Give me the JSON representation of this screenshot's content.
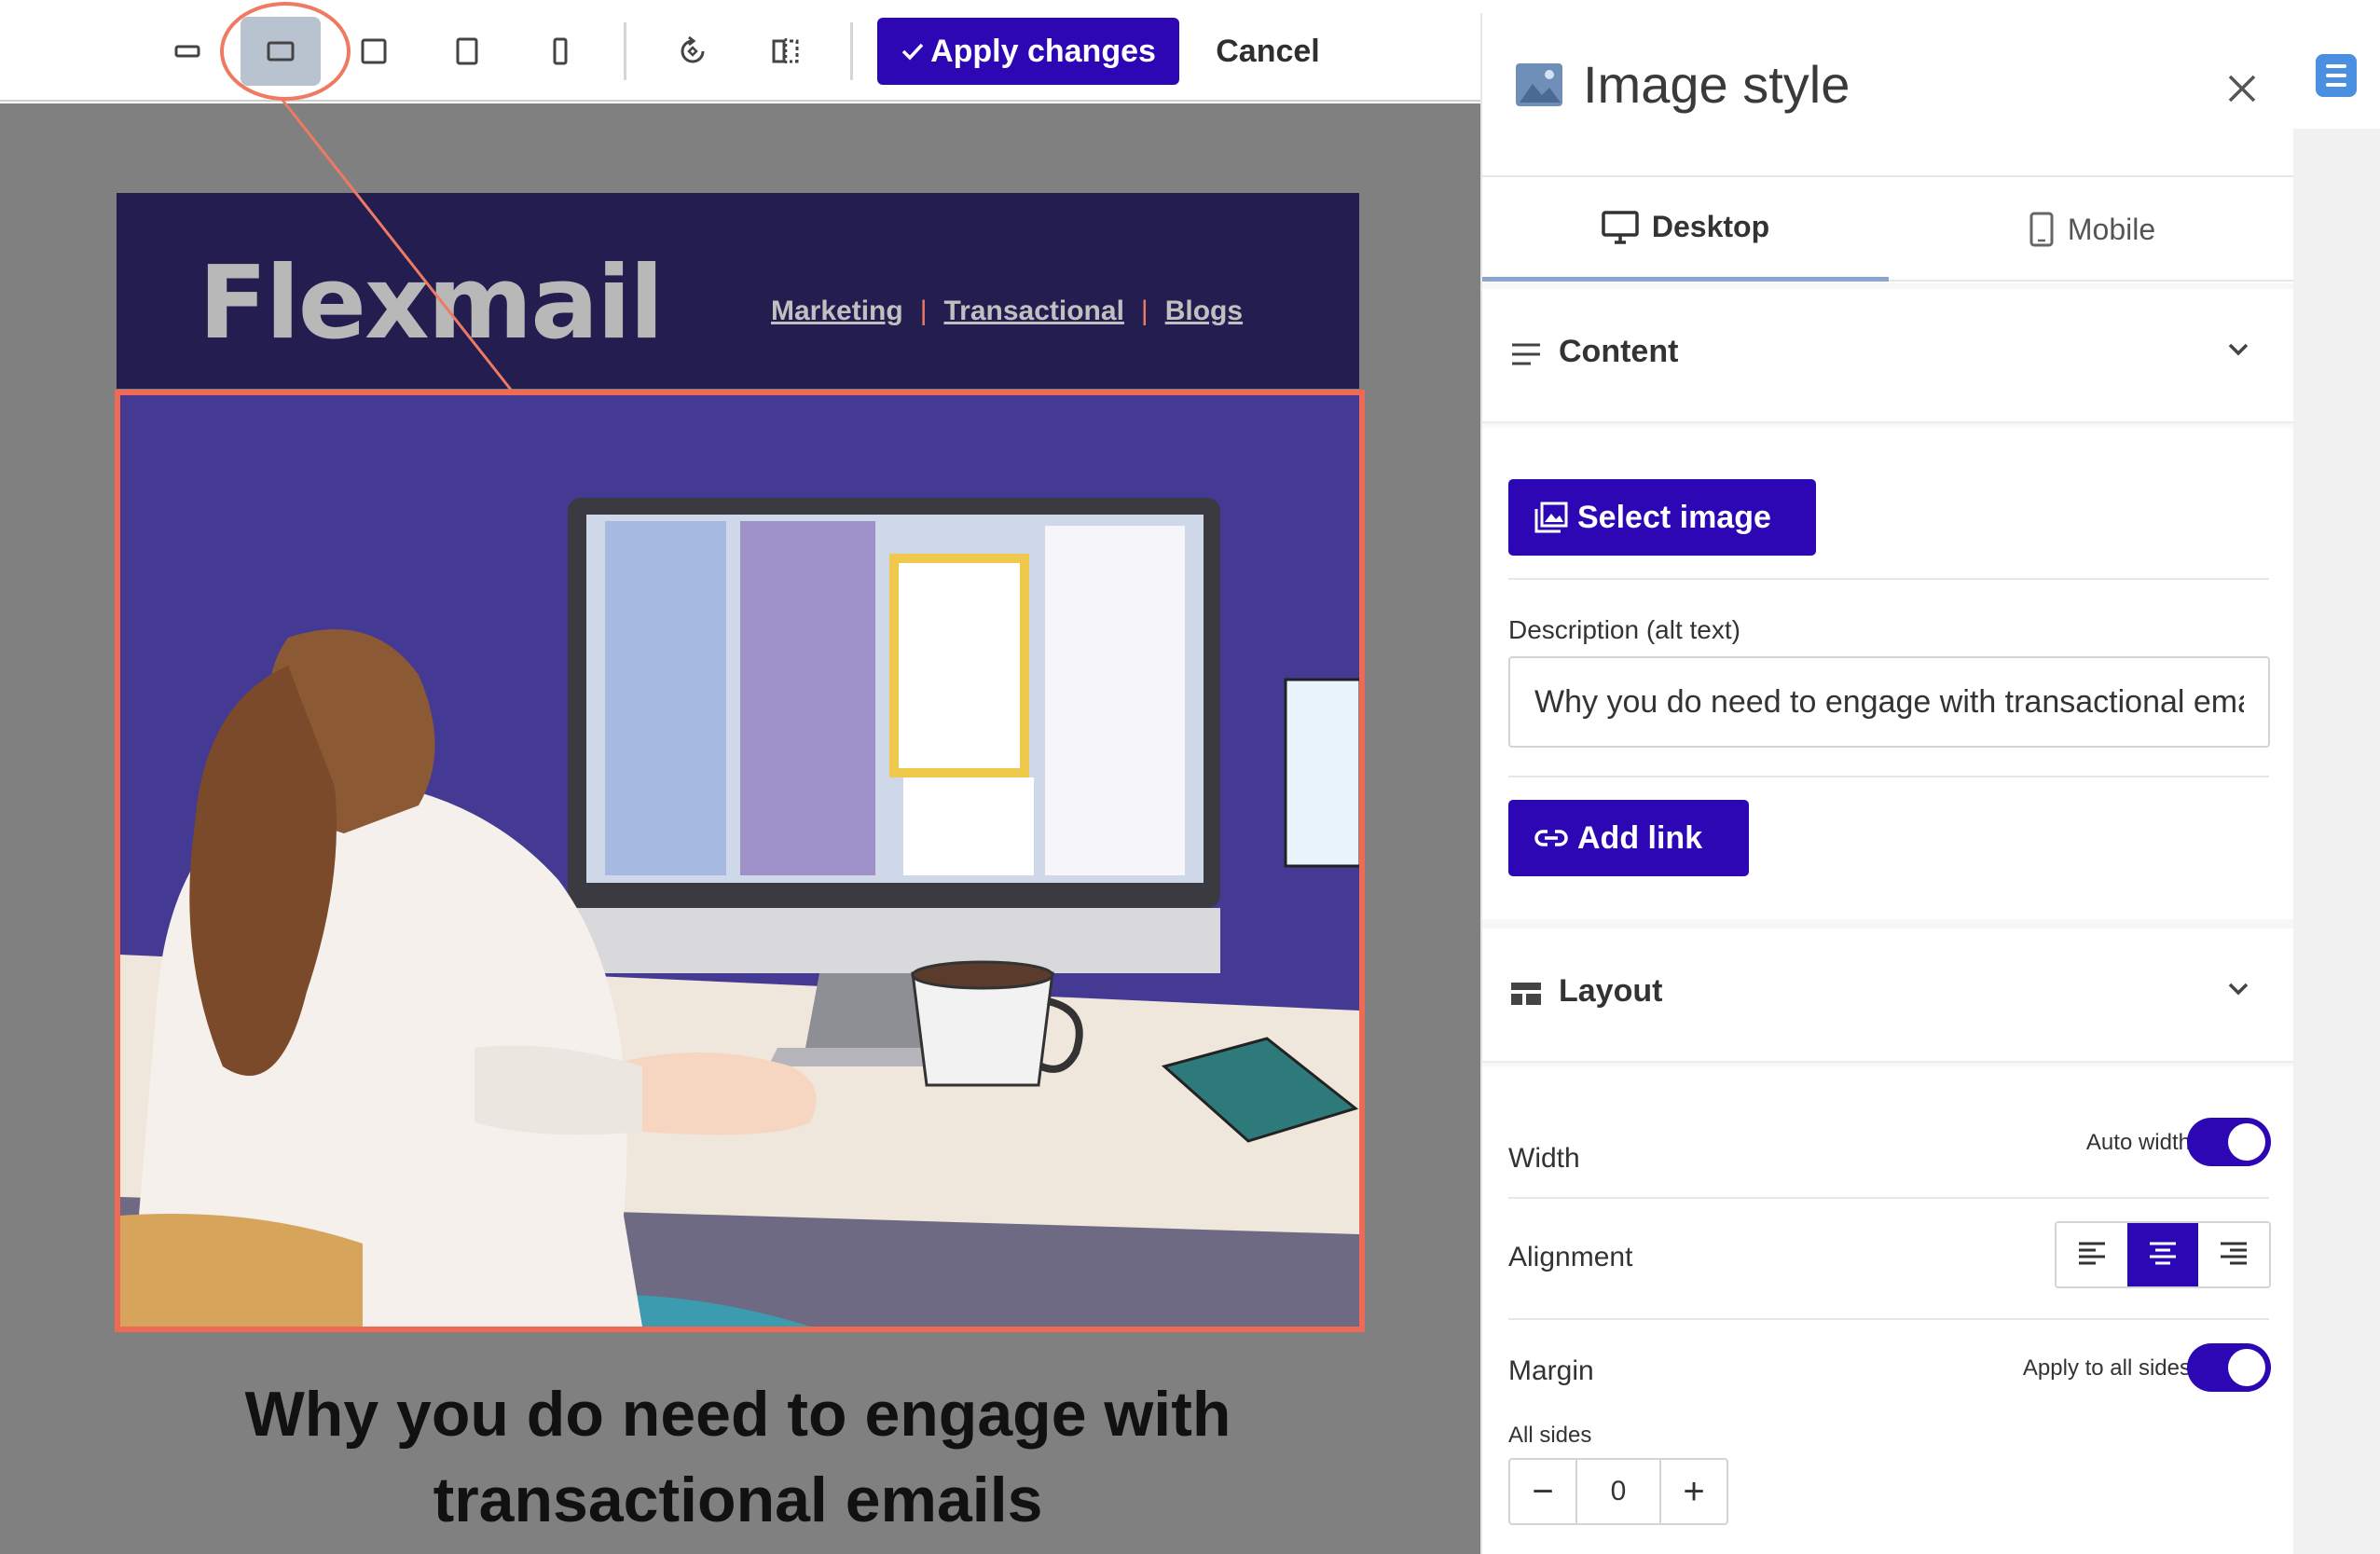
{
  "toolbar": {
    "size_options": [
      "extra-wide",
      "wide",
      "square",
      "portrait",
      "narrow"
    ],
    "active_size": "wide",
    "apply_label": "Apply changes",
    "cancel_label": "Cancel"
  },
  "email": {
    "brand": "Flexmail",
    "nav": [
      "Marketing",
      "Transactional",
      "Blogs"
    ],
    "headline": "Why you do need to engage with transactional emails"
  },
  "panel": {
    "title": "Image style",
    "tabs": [
      {
        "label": "Desktop",
        "active": true
      },
      {
        "label": "Mobile",
        "active": false
      }
    ],
    "content": {
      "section_title": "Content",
      "select_image_label": "Select image",
      "alt_label": "Description (alt text)",
      "alt_value": "Why you do need to engage with transactional emails",
      "add_link_label": "Add link"
    },
    "layout": {
      "section_title": "Layout",
      "width_label": "Width",
      "auto_width_label": "Auto width",
      "auto_width_on": true,
      "alignment_label": "Alignment",
      "alignment_options": [
        "left",
        "center",
        "right"
      ],
      "alignment_selected": "center",
      "margin_label": "Margin",
      "apply_all_label": "Apply to all sides",
      "apply_all_on": true,
      "all_sides_label": "All sides",
      "margin_value": "0",
      "minus": "−",
      "plus": "+"
    }
  },
  "colors": {
    "accent": "#2d07b4",
    "highlight": "#ee6a55",
    "email_header_bg": "#231e4f",
    "hero_bg": "#443a93"
  }
}
